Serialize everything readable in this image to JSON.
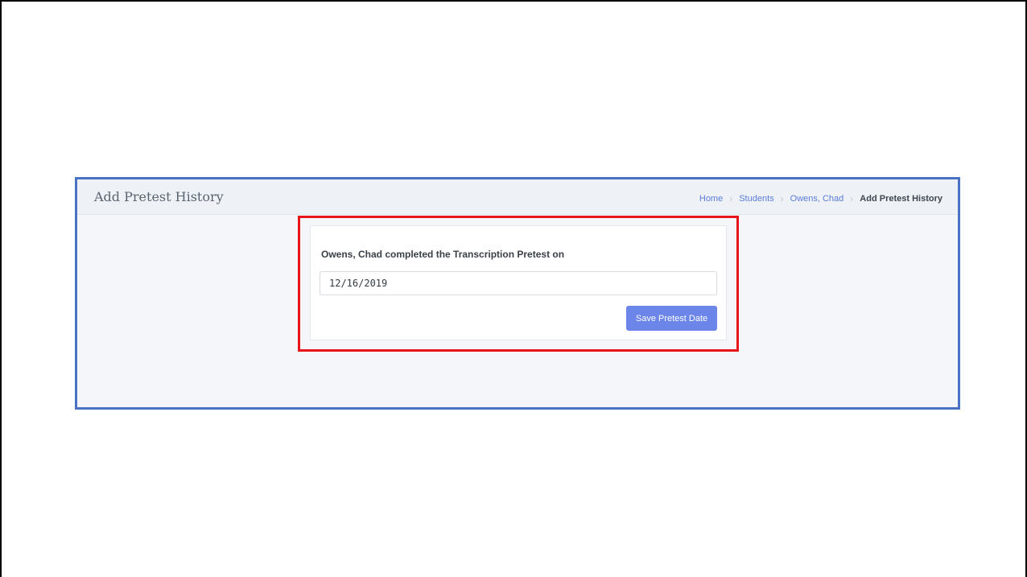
{
  "header": {
    "title": "Add Pretest History"
  },
  "breadcrumb": {
    "items": [
      {
        "label": "Home"
      },
      {
        "label": "Students"
      },
      {
        "label": "Owens, Chad"
      },
      {
        "label": "Add Pretest History"
      }
    ],
    "separator": "›"
  },
  "form": {
    "label": "Owens, Chad completed the Transcription Pretest on",
    "date_value": "12/16/2019",
    "save_label": "Save Pretest Date"
  },
  "colors": {
    "accent": "#6b85e8",
    "link": "#5b7bd8",
    "window_border": "#4a72c4",
    "highlight": "#e8141c"
  }
}
